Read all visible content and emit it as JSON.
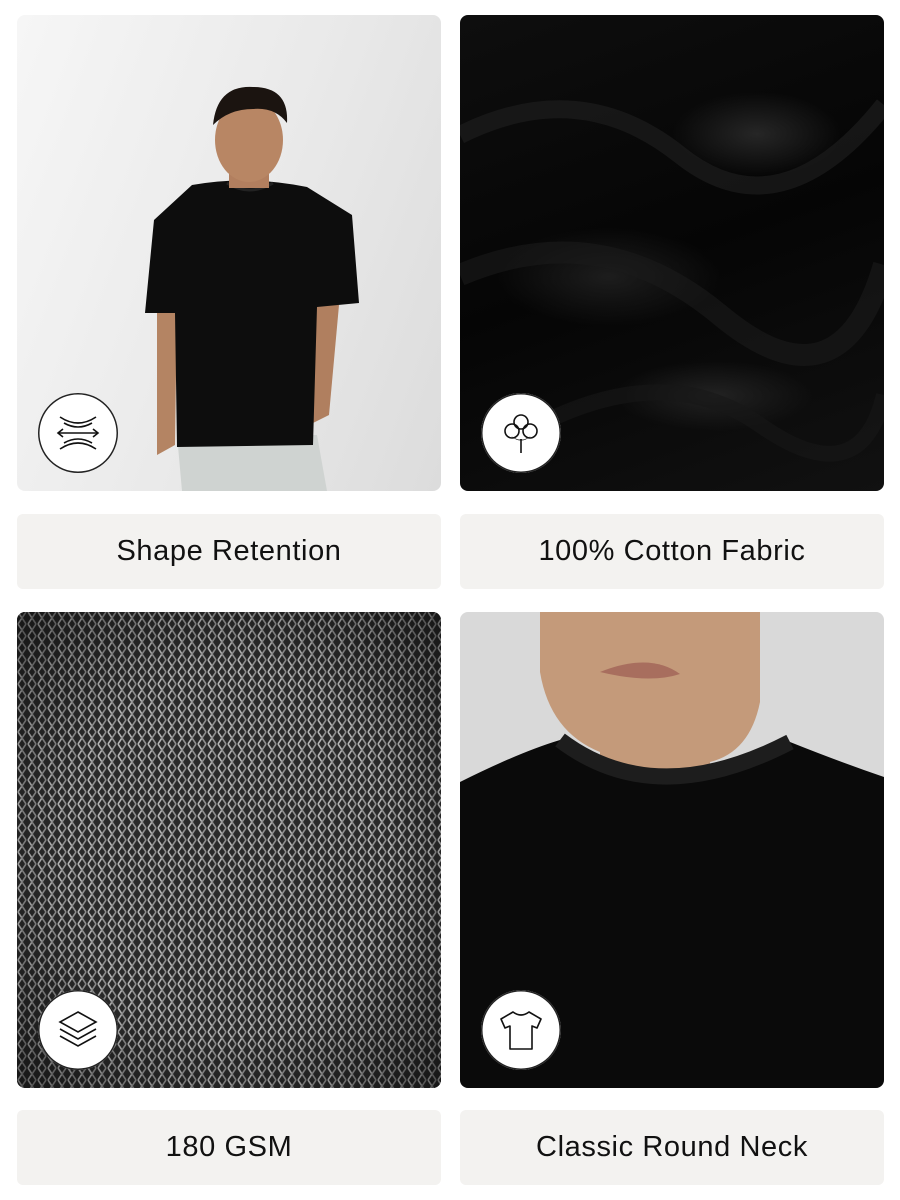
{
  "features": [
    {
      "label": "Shape Retention",
      "icon": "stretch-arrows-icon"
    },
    {
      "label": "100% Cotton Fabric",
      "icon": "cotton-flower-icon"
    },
    {
      "label": "180 GSM",
      "icon": "layers-icon"
    },
    {
      "label": "Classic Round Neck",
      "icon": "tshirt-icon"
    }
  ],
  "colors": {
    "label_background": "#f3f2f0",
    "label_text": "#111111",
    "tee_black": "#0a0a0a"
  }
}
